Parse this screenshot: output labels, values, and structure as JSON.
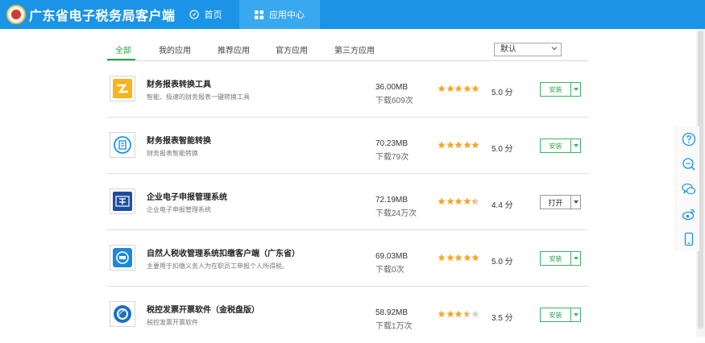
{
  "header": {
    "title": "广东省电子税务局客户端",
    "nav": [
      {
        "label": "首页",
        "icon": "compass-icon"
      },
      {
        "label": "应用中心",
        "icon": "grid-icon"
      }
    ]
  },
  "tabs": [
    "全部",
    "我的应用",
    "推荐应用",
    "官方应用",
    "第三方应用"
  ],
  "sort": {
    "selected": "默认"
  },
  "apps": [
    {
      "name": "财务报表转换工具",
      "desc": "智能、极速的财务报表一键转换工具",
      "size": "36.00MB",
      "downloads": "下载609次",
      "rating": 5.0,
      "score": "5.0 分",
      "action": "安装"
    },
    {
      "name": "财务报表智能转换",
      "desc": "财务报表智能转换",
      "size": "70.23MB",
      "downloads": "下载79次",
      "rating": 5.0,
      "score": "5.0 分",
      "action": "安装"
    },
    {
      "name": "企业电子申报管理系统",
      "desc": "企业电子申报管理系统",
      "size": "72.19MB",
      "downloads": "下载24万次",
      "rating": 4.4,
      "score": "4.4 分",
      "action": "打开"
    },
    {
      "name": "自然人税收管理系统扣缴客户端（广东省）",
      "desc": "主要用于扣缴义务人为在职员工申报个人所得税。",
      "size": "69.03MB",
      "downloads": "下载0次",
      "rating": 5.0,
      "score": "5.0 分",
      "action": "安装"
    },
    {
      "name": "税控发票开票软件（金税盘版）",
      "desc": "税控发票开票软件",
      "size": "58.92MB",
      "downloads": "下载1万次",
      "rating": 3.5,
      "score": "3.5 分",
      "action": "安装"
    }
  ],
  "sidebar": [
    "help-icon",
    "search-icon",
    "chat-icon",
    "weibo-icon",
    "mobile-icon"
  ],
  "colors": {
    "header": "#1a94e6",
    "accent": "#2aa34a",
    "star": "#f5a623"
  }
}
